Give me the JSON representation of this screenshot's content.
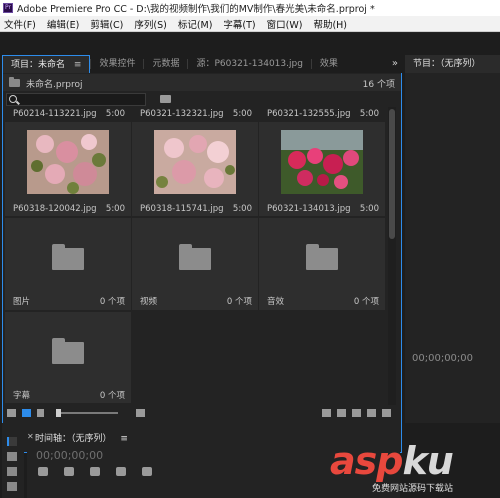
{
  "window": {
    "title": "Adobe Premiere Pro CC - D:\\我的视频制作\\我们的MV制作\\春光美\\未命名.prproj *"
  },
  "menu": [
    "文件(F)",
    "编辑(E)",
    "剪辑(C)",
    "序列(S)",
    "标记(M)",
    "字幕(T)",
    "窗口(W)",
    "帮助(H)"
  ],
  "project_tabs": {
    "active_label": "项目：未命名",
    "menu_glyph": "≡",
    "others": [
      "效果控件",
      "元数据",
      "源：P60321-134013.jpg",
      "效果"
    ],
    "more_glyph": "»"
  },
  "project": {
    "filename": "未命名.prproj",
    "item_count": "16 个项"
  },
  "top_row": [
    {
      "name": "P60214-113221.jpg",
      "duration": "5:00"
    },
    {
      "name": "P60321-132321.jpg",
      "duration": "5:00"
    },
    {
      "name": "P60321-132555.jpg",
      "duration": "5:00"
    }
  ],
  "clips": [
    {
      "name": "P60318-120042.jpg",
      "duration": "5:00",
      "palette": "cherry"
    },
    {
      "name": "P60318-115741.jpg",
      "duration": "5:00",
      "palette": "cherry"
    },
    {
      "name": "P60321-134013.jpg",
      "duration": "5:00",
      "palette": "magenta"
    }
  ],
  "bins": [
    {
      "name": "图片",
      "count": "0 个项"
    },
    {
      "name": "视频",
      "count": "0 个项"
    },
    {
      "name": "音效",
      "count": "0 个项"
    },
    {
      "name": "字幕",
      "count": "0 个项"
    }
  ],
  "program": {
    "tab_label": "节目：（无序列）",
    "timecode": "00;00;00;00"
  },
  "timeline": {
    "tab_label": "时间轴：（无序列）",
    "menu_glyph": "≡",
    "timecode": "00;00;00;00"
  },
  "watermark": {
    "main": "asp",
    "tail": "ku",
    "sub": "免费网站源码下载站"
  },
  "colors": {
    "accent": "#2d8ceb",
    "watermark_red": "#e8483d"
  }
}
